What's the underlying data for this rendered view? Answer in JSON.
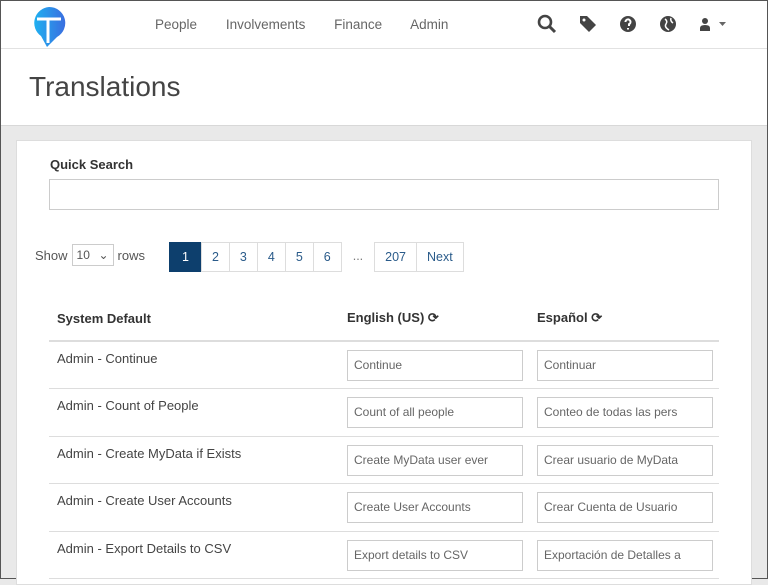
{
  "nav": {
    "links": [
      "People",
      "Involvements",
      "Finance",
      "Admin"
    ]
  },
  "page": {
    "title": "Translations"
  },
  "search": {
    "label": "Quick Search",
    "value": ""
  },
  "paging": {
    "show": "Show",
    "rows_value": "10",
    "rows": "rows",
    "pages": [
      "1",
      "2",
      "3",
      "4",
      "5",
      "6"
    ],
    "ellipsis": "...",
    "last": "207",
    "next": "Next"
  },
  "table": {
    "headers": [
      "System Default",
      "English (US)",
      "Español"
    ],
    "rows": [
      [
        "Admin - Continue",
        "Continue",
        "Continuar"
      ],
      [
        "Admin - Count of People",
        "Count of all people",
        "Conteo de todas las pers"
      ],
      [
        "Admin - Create MyData if Exists",
        "Create MyData user ever",
        "Crear usuario de MyData"
      ],
      [
        "Admin - Create User Accounts",
        "Create User Accounts",
        "Crear Cuenta de Usuario"
      ],
      [
        "Admin - Export Details to CSV",
        "Export details to CSV",
        "Exportación de Detalles a"
      ]
    ]
  },
  "colors": {
    "accent": "#0d3f6d"
  }
}
